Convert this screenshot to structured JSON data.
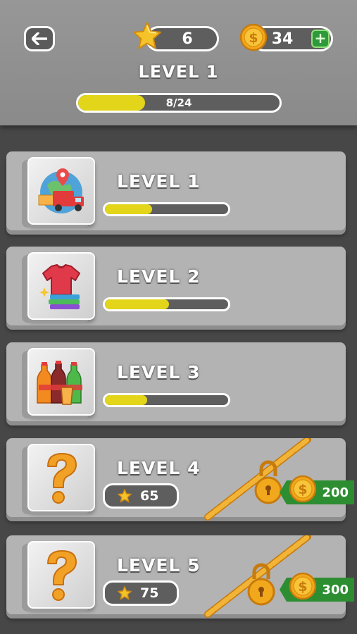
{
  "header": {
    "stars": "6",
    "coins": "34",
    "plus": "+",
    "title": "LEVEL 1",
    "progress_text": "8/24",
    "progress_fraction": 0.333
  },
  "levels": [
    {
      "title": "LEVEL 1",
      "icon": "delivery-truck-globe-icon",
      "progress": 0.38
    },
    {
      "title": "LEVEL 2",
      "icon": "clothes-tshirt-icon",
      "progress": 0.52
    },
    {
      "title": "LEVEL 3",
      "icon": "soda-bottles-icon",
      "progress": 0.34
    },
    {
      "title": "LEVEL 4",
      "icon": "question-mark-icon",
      "locked": true,
      "stars_required": "65",
      "price": "200"
    },
    {
      "title": "LEVEL 5",
      "icon": "question-mark-icon",
      "locked": true,
      "stars_required": "75",
      "price": "300"
    }
  ],
  "colors": {
    "progress_fill": "#e2d51a",
    "price_tag": "#2d8d31",
    "coin": "#f2a81d"
  }
}
